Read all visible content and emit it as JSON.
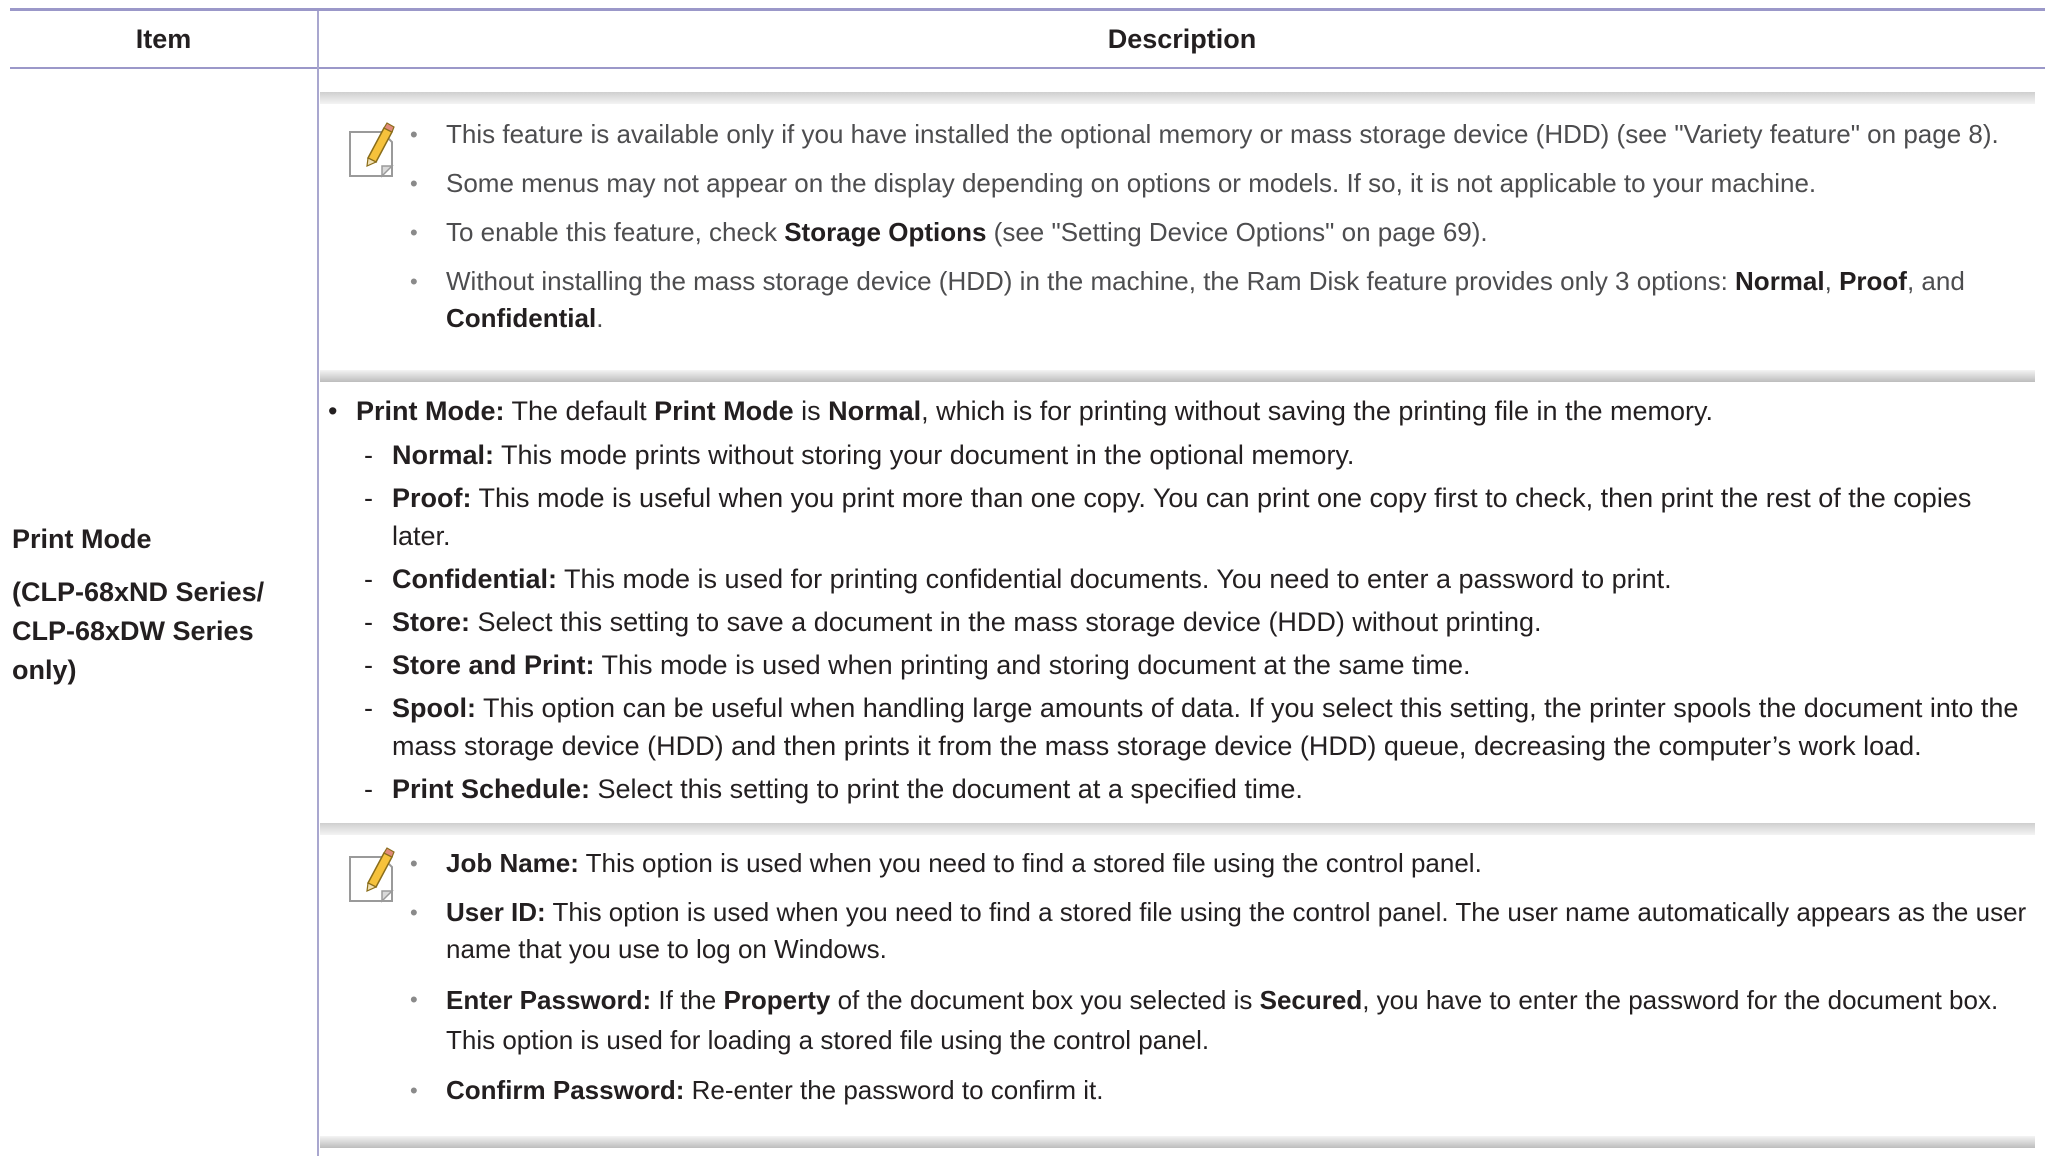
{
  "header": {
    "item": "Item",
    "description": "Description"
  },
  "item": {
    "title": "Print Mode",
    "subtitle": "(CLP-68xND Series/ CLP-68xDW Series only)"
  },
  "note1": {
    "b1": "This feature is available only if you have installed the optional memory or mass storage device (HDD) (see \"Variety feature\" on page 8).",
    "b2": "Some menus may not appear on the display depending on options or models. If so, it is not applicable to your machine.",
    "b3_pre": "To enable this feature, check ",
    "b3_bold": "Storage Options",
    "b3_post": " (see \"Setting Device Options\" on page 69).",
    "b4_pre": "Without installing the mass storage device (HDD) in the machine, the Ram Disk feature provides only 3 options: ",
    "b4_normal": "Normal",
    "b4_comma": ", ",
    "b4_proof": "Proof",
    "b4_and": ", and ",
    "b4_conf": "Confidential",
    "b4_end": "."
  },
  "main": {
    "lead_label": "Print Mode:",
    "lead_t1": " The default ",
    "lead_b1": "Print Mode",
    "lead_t2": " is ",
    "lead_b2": "Normal",
    "lead_t3": ", which is for printing without saving the printing file in the memory.",
    "items": [
      {
        "label": "Normal:",
        "text": " This mode prints without storing your document in the optional memory."
      },
      {
        "label": "Proof:",
        "text": " This mode is useful when you print more than one copy. You can print one copy first to check, then print the rest of the copies later."
      },
      {
        "label": "Confidential:",
        "text": " This mode is used for printing confidential documents. You need to enter a password to print."
      },
      {
        "label": "Store:",
        "text": " Select this setting to save a document in the mass storage device (HDD) without printing."
      },
      {
        "label": "Store and Print:",
        "text": " This mode is used when printing and storing document at the same time."
      },
      {
        "label": "Spool:",
        "text": " This option can be useful when handling large amounts of data. If you select this setting, the printer spools the document into the mass storage device (HDD) and then prints it from the mass storage device (HDD) queue, decreasing the computer’s work load."
      },
      {
        "label": "Print Schedule:",
        "text": " Select this setting to print the document at a specified time."
      }
    ]
  },
  "note2": {
    "jn_label": "Job Name:",
    "jn_text": " This option is used when you need to find a stored file using the control panel.",
    "uid_label": "User ID:",
    "uid_text": " This option is used when you need to find a stored file using the control panel. The user name automatically appears as the user name that you use to log on Windows.",
    "ep_label": "Enter Password:",
    "ep_t1": " If the ",
    "ep_b1": "Property",
    "ep_t2": " of the document box you selected is ",
    "ep_b2": "Secured",
    "ep_t3": ", you have to enter the password for the document box.  This option is used for loading a stored file using the control panel.",
    "cp_label": "Confirm Password:",
    "cp_text": " Re-enter the password to confirm it."
  }
}
